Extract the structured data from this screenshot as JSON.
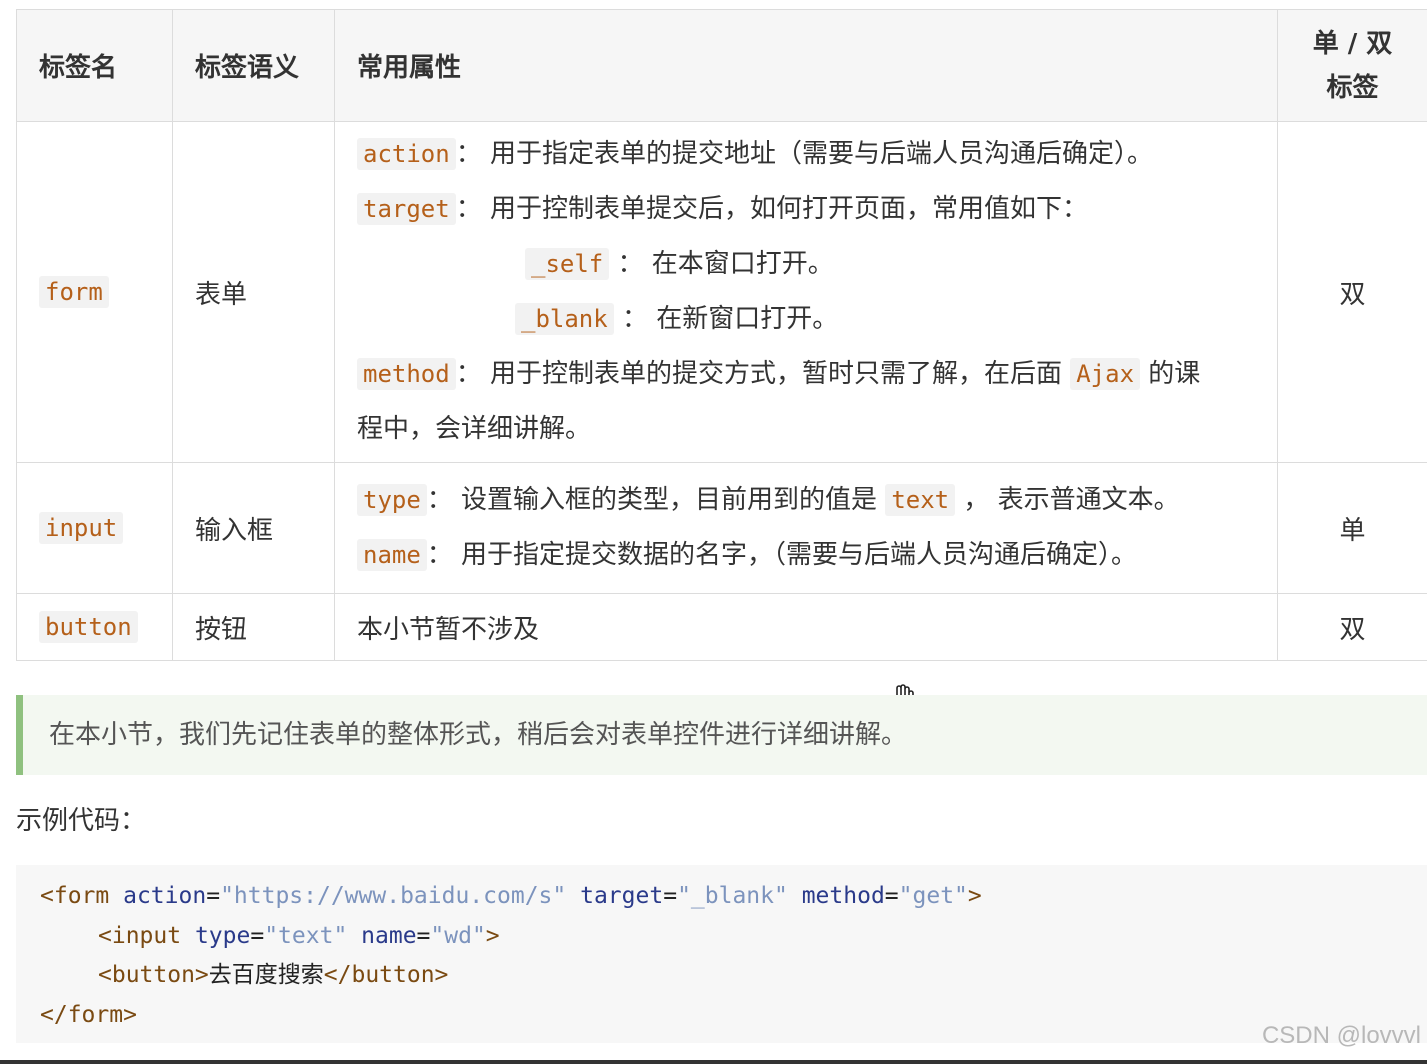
{
  "table": {
    "headers": [
      "标签名",
      "标签语义",
      "常用属性"
    ],
    "header_last": [
      "单 / 双",
      "标签"
    ],
    "form": {
      "tag": "form",
      "semantic": "表单",
      "lines": [
        {
          "code": "action",
          "text": "： 用于指定表单的提交地址（需要与后端人员沟通后确定）。"
        },
        {
          "code": "target",
          "text": "： 用于控制表单提交后，如何打开页面，常用值如下："
        },
        {
          "code": "_self",
          "text": " ： 在本窗口打开。"
        },
        {
          "code": "_blank",
          "text": " ： 在新窗口打开。"
        },
        {
          "code": "method",
          "text": "： 用于控制表单的提交方式，暂时只需了解，在后面 ",
          "code2": "Ajax",
          "text2": " 的课"
        }
      ],
      "continuation": "程中，会详细讲解。",
      "type": "双"
    },
    "input": {
      "tag": "input",
      "semantic": "输入框",
      "lines": [
        {
          "code": "type",
          "text": "： 设置输入框的类型，目前用到的值是 ",
          "code2": "text",
          "text2": " ， 表示普通文本。"
        },
        {
          "code": "name",
          "text": "： 用于指定提交数据的名字，（需要与后端人员沟通后确定）。"
        }
      ],
      "type": "单"
    },
    "button": {
      "tag": "button",
      "semantic": "按钮",
      "attrs": "本小节暂不涉及",
      "type": "双"
    }
  },
  "tip": "在本小节，我们先记住表单的整体形式，稍后会对表单控件进行详细讲解。",
  "example_title": "示例代码：",
  "code": {
    "l1": {
      "open": "<form",
      "a1": "action",
      "eq": "=",
      "v1": "\"https://www.baidu.com/s\"",
      "a2": "target",
      "v2": "\"_blank\"",
      "a3": "method",
      "v3": "\"get\"",
      "close": ">"
    },
    "l2": {
      "open": "<input",
      "a1": "type",
      "eq": "=",
      "v1": "\"text\"",
      "a2": "name",
      "v2": "\"wd\"",
      "close": ">"
    },
    "l3": {
      "open": "<button>",
      "text": "去百度搜索",
      "close": "</button>"
    },
    "l4": {
      "close": "</form>"
    }
  },
  "watermark": "CSDN @lovvvl"
}
